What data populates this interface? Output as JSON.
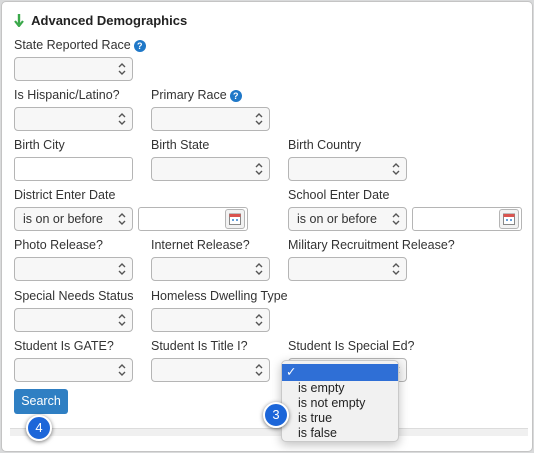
{
  "section": {
    "title": "Advanced Demographics"
  },
  "fields": {
    "state_reported_race": {
      "label": "State Reported Race",
      "value": ""
    },
    "is_hispanic": {
      "label": "Is Hispanic/Latino?",
      "value": ""
    },
    "primary_race": {
      "label": "Primary Race",
      "value": ""
    },
    "birth_city": {
      "label": "Birth City",
      "value": ""
    },
    "birth_state": {
      "label": "Birth State",
      "value": ""
    },
    "birth_country": {
      "label": "Birth Country",
      "value": ""
    },
    "district_enter_date": {
      "label": "District Enter Date",
      "operator": "is on or before",
      "value": ""
    },
    "school_enter_date": {
      "label": "School Enter Date",
      "operator": "is on or before",
      "value": ""
    },
    "photo_release": {
      "label": "Photo Release?",
      "value": ""
    },
    "internet_release": {
      "label": "Internet Release?",
      "value": ""
    },
    "military_release": {
      "label": "Military Recruitment Release?",
      "value": ""
    },
    "special_needs_status": {
      "label": "Special Needs Status",
      "value": ""
    },
    "homeless_dwelling_type": {
      "label": "Homeless Dwelling Type",
      "value": ""
    },
    "student_is_gate": {
      "label": "Student Is GATE?",
      "value": ""
    },
    "student_is_title_i": {
      "label": "Student Is Title I?",
      "value": ""
    },
    "student_is_special_ed": {
      "label": "Student Is Special Ed?",
      "value": ""
    }
  },
  "dropdown_menu": {
    "selected_mark": "✓",
    "options": [
      "is empty",
      "is not empty",
      "is true",
      "is false"
    ]
  },
  "search_button": {
    "label": "Search"
  },
  "step_badges": {
    "search_step": "4",
    "menu_step": "3"
  },
  "colors": {
    "accent": "#2f7fc3",
    "badge": "#1c66d9",
    "menu_highlight": "#2f6fd6",
    "help_icon": "#1f78c8"
  },
  "icons": {
    "section_toggle": "green-down-arrow-icon",
    "help": "help-circle-icon",
    "calendar": "calendar-icon",
    "select_caret": "up-down-caret-icon"
  }
}
